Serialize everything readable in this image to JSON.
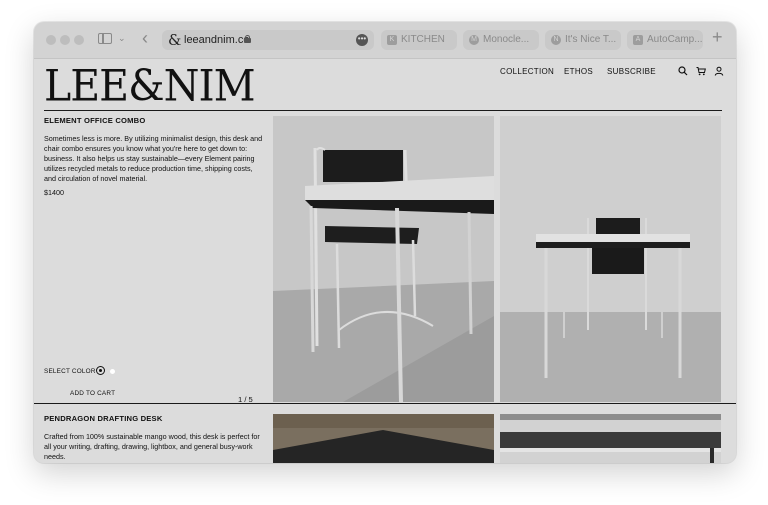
{
  "browser": {
    "url": "leeandnim.co",
    "url_logo": "&",
    "tabs": [
      {
        "label": "KITCHEN",
        "icon": "K"
      },
      {
        "label": "Monocle...",
        "icon": "M"
      },
      {
        "label": "It's Nice T...",
        "icon": "N"
      },
      {
        "label": "AutoCamp...",
        "icon": "A"
      }
    ],
    "more": "•••",
    "back": "‹",
    "new_tab": "+"
  },
  "site": {
    "logo": "LEE&NIM",
    "nav": [
      "COLLECTION",
      "ETHOS",
      "SUBSCRIBE"
    ],
    "icons": [
      "search-icon",
      "cart-icon",
      "user-icon"
    ]
  },
  "products": [
    {
      "title": "ELEMENT OFFICE COMBO",
      "description": "Sometimes less is more. By utilizing minimalist design, this desk and chair combo ensures you know what you're here to get down to: business. It also helps us stay sustainable—every Element pairing utilizes recycled metals to reduce production time, shipping costs, and circulation of novel material.",
      "price": "$1400",
      "select_color": "SELECT COLOR",
      "colors": [
        "#111111",
        "#ffffff"
      ],
      "add_to_cart": "ADD TO CART",
      "pager": "1 / 5"
    },
    {
      "title": "PENDRAGON DRAFTING DESK",
      "description": "Crafted from 100% sustainable mango wood, this desk is perfect for all your writing, drafting, drawing, lightbox, and general busy-work needs."
    }
  ],
  "colors": {
    "window_bg": "#dcdcdc",
    "chrome_bg": "#d3d3d3",
    "text": "#111111"
  }
}
